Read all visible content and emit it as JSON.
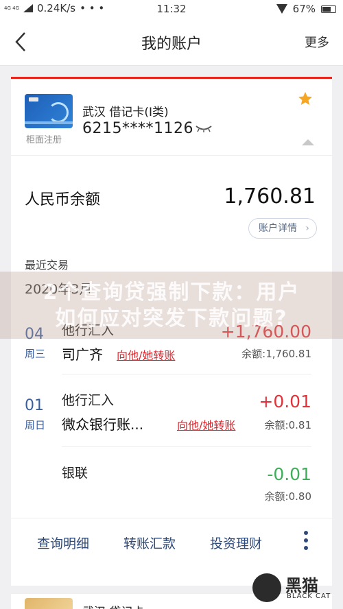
{
  "status_bar": {
    "network": "0.24K/s",
    "signal_label": "4G 4G",
    "dots": "• • •",
    "time": "11:32",
    "battery_pct": "67%"
  },
  "navbar": {
    "title": "我的账户",
    "more_label": "更多"
  },
  "account": {
    "card_caption": "柜面注册",
    "city_type": "武汉  借记卡(I类)",
    "number": "6215****1126"
  },
  "balance": {
    "label": "人民币余额",
    "value": "1,760.81",
    "detail_button": "账户详情"
  },
  "transactions_section": {
    "title": "最近交易",
    "month": "2020年3月"
  },
  "transactions": [
    {
      "day": "04",
      "weekday": "周三",
      "type": "他行汇入",
      "name": "司广齐",
      "link": "向他/她转账",
      "amount": "+1,760.00",
      "balance": "余额:1,760.81",
      "amount_color": "#e0323a"
    },
    {
      "day": "01",
      "weekday": "周日",
      "type": "他行汇入",
      "name": "微众银行账...",
      "link": "向他/她转账",
      "amount": "+0.01",
      "balance": "余额:0.81",
      "amount_color": "#e0323a"
    },
    {
      "day": "",
      "weekday": "",
      "type": "银联",
      "name": "",
      "link": "",
      "amount": "-0.01",
      "balance": "余额:0.80",
      "amount_color": "#3fae5a"
    }
  ],
  "actions": {
    "query": "查询明细",
    "transfer": "转账汇款",
    "invest": "投资理财"
  },
  "next_card": {
    "text": "武汉  贷记卡"
  },
  "watermark": {
    "line1": "2个查询贷强制下款：用户",
    "line2": "如何应对突发下款问题?"
  },
  "logo": {
    "cn": "黑猫",
    "en": "BLACK CAT"
  }
}
